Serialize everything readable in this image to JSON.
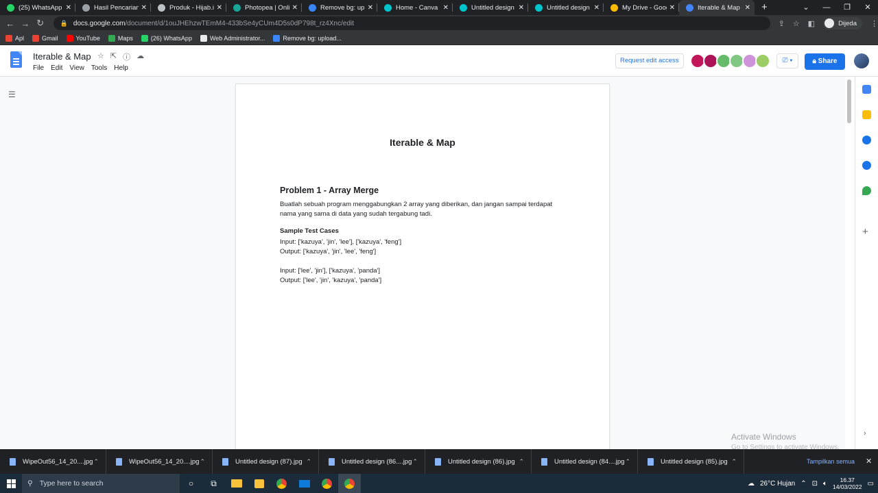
{
  "browser": {
    "tabs": [
      {
        "title": "(25) WhatsApp",
        "icon": "whatsapp-icon",
        "color": "#25d366"
      },
      {
        "title": "Hasil Pencarian dir",
        "icon": "page-icon",
        "color": "#9aa0a6"
      },
      {
        "title": "Produk - Hijab.id",
        "icon": "globe-icon",
        "color": "#bdc1c6"
      },
      {
        "title": "Photopea | Online",
        "icon": "photopea-icon",
        "color": "#18a497"
      },
      {
        "title": "Remove bg: uploa",
        "icon": "removebg-icon",
        "color": "#3b86f7"
      },
      {
        "title": "Home - Canva",
        "icon": "canva-icon",
        "color": "#00c4cc"
      },
      {
        "title": "Untitled design - Y",
        "icon": "canva-icon",
        "color": "#00c4cc"
      },
      {
        "title": "Untitled design - Y",
        "icon": "canva-icon",
        "color": "#00c4cc"
      },
      {
        "title": "My Drive - Google",
        "icon": "drive-icon",
        "color": "#fbbc04"
      },
      {
        "title": "Iterable & Map - G",
        "icon": "docs-icon",
        "color": "#4285f4",
        "active": true
      }
    ],
    "url_host": "docs.google.com",
    "url_path": "/document/d/1ouJHEhzwTEmM4-433bSe4yCUm4D5s0dP798t_rz4Xnc/edit",
    "profile_name": "Dijeda",
    "bookmarks": [
      {
        "label": "Apl",
        "color": "#ea4335"
      },
      {
        "label": "Gmail",
        "color": "#ea4335"
      },
      {
        "label": "YouTube",
        "color": "#ff0000"
      },
      {
        "label": "Maps",
        "color": "#34a853"
      },
      {
        "label": "(26) WhatsApp",
        "color": "#25d366"
      },
      {
        "label": "Web Administrator...",
        "color": "#e8eaed"
      },
      {
        "label": "Remove bg: upload...",
        "color": "#3b86f7"
      }
    ]
  },
  "docs": {
    "title": "Iterable & Map",
    "menu": [
      "File",
      "Edit",
      "View",
      "Tools",
      "Help"
    ],
    "request_edit": "Request edit access",
    "share": "Share",
    "avatar_colors": [
      "#c2185b",
      "#ad1457",
      "#66bb6a",
      "#81c784",
      "#ce93d8",
      "#9ccc65"
    ]
  },
  "document": {
    "heading": "Iterable & Map",
    "problem_title": "Problem 1 - Array Merge",
    "description": "Buatlah sebuah program menggabungkan 2 array yang diberikan, dan jangan sampai terdapat nama yang sama di data yang sudah tergabung tadi.",
    "sample_title": "Sample Test Cases",
    "input1": "Input: ['kazuya', 'jin', 'lee'], ['kazuya', 'feng']",
    "output1": "Output: ['kazuya', 'jin', 'lee', 'feng']",
    "input2": "Input: ['lee', 'jin'], ['kazuya', 'panda']",
    "output2": "Output: ['lee', 'jin', 'kazuya', 'panda']"
  },
  "watermark": {
    "line1": "Activate Windows",
    "line2": "Go to Settings to activate Windows."
  },
  "downloads": {
    "files": [
      "WipeOut56_14_20....jpg",
      "WipeOut56_14_20....jpg",
      "Untitled design (87).jpg",
      "Untitled design (86....jpg",
      "Untitled design (86).jpg",
      "Untitled design (84....jpg",
      "Untitled design (85).jpg"
    ],
    "show_all": "Tampilkan semua"
  },
  "taskbar": {
    "search_placeholder": "Type here to search",
    "weather": "26°C  Hujan",
    "time": "16.37",
    "date": "14/03/2022"
  }
}
